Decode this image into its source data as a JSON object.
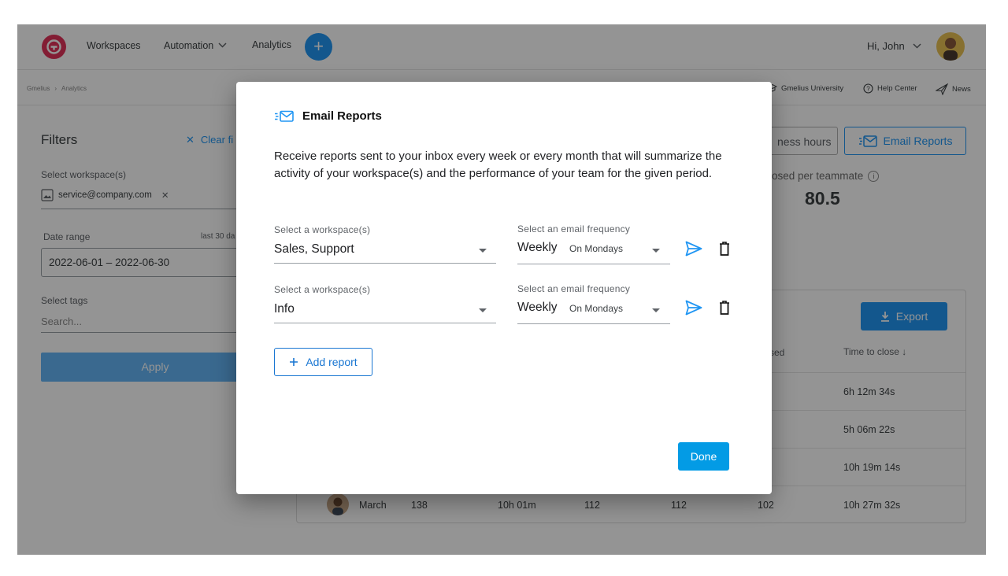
{
  "topbar": {
    "nav": [
      "Workspaces",
      "Automation",
      "Analytics"
    ],
    "greeting": "Hi, John"
  },
  "breadcrumb": [
    "Gmelius",
    "Analytics"
  ],
  "toplinks": [
    "Gmelius University",
    "Help Center",
    "News"
  ],
  "filters": {
    "title": "Filters",
    "clear_label": "Clear fi",
    "workspace_label": "Select workspace(s)",
    "workspace_chip": "service@company.com",
    "date_label": "Date range",
    "date_hint": "last 30 da",
    "date_value": "2022-06-01 – 2022-06-30",
    "tags_label": "Select tags",
    "tags_placeholder": "Search...",
    "apply_label": "Apply"
  },
  "dashboard": {
    "business_hours_label": "ness hours",
    "email_reports_label": "Email Reports",
    "metric_label": "osed per teammate",
    "metric_value": "80.5",
    "export_label": "Export",
    "headers": [
      "sed",
      "Time to close ↓"
    ],
    "time_to_close": [
      "6h 12m 34s",
      "5h 06m 22s",
      "10h 19m 14s",
      "10h 27m 32s"
    ],
    "last_row": {
      "name": "March",
      "c1": "138",
      "c2": "10h 01m",
      "c3": "112",
      "c4": "112",
      "c5": "102"
    }
  },
  "modal": {
    "title": "Email Reports",
    "description": "Receive reports sent to your inbox every week or every month that will summarize the activity of your workspace(s) and the performance of your team for the given period.",
    "rows": [
      {
        "workspace_label": "Select a workspace(s)",
        "workspace_value": "Sales, Support",
        "frequency_label": "Select an email frequency",
        "frequency_value": "Weekly",
        "frequency_day": "On Mondays"
      },
      {
        "workspace_label": "Select a workspace(s)",
        "workspace_value": "Info",
        "frequency_label": "Select an email frequency",
        "frequency_value": "Weekly",
        "frequency_day": "On Mondays"
      }
    ],
    "add_label": "Add report",
    "done_label": "Done"
  },
  "colors": {
    "accent": "#2196f3",
    "brand": "#e2325a",
    "done": "#039be5"
  }
}
